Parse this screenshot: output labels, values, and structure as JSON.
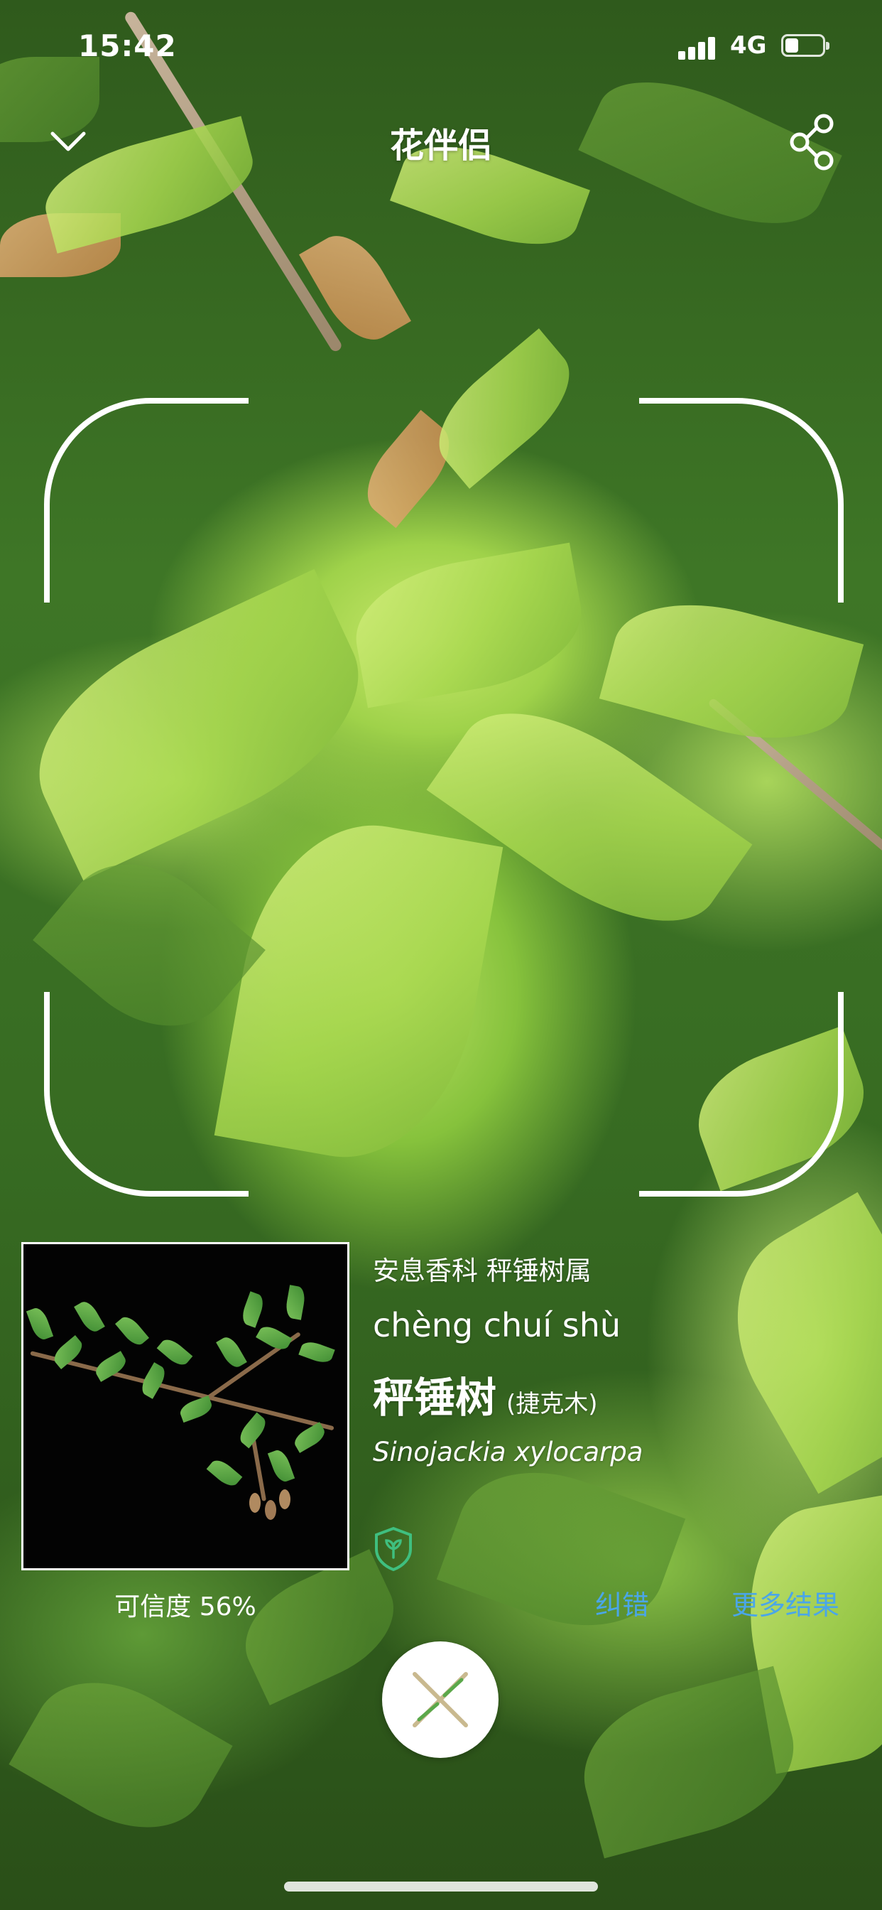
{
  "status_bar": {
    "time": "15:42",
    "network": "4G",
    "icons": [
      "signal-icon",
      "battery-icon"
    ]
  },
  "nav": {
    "title": "花伴侣",
    "left_icon": "chevron-down-icon",
    "right_icon": "share-icon"
  },
  "result": {
    "taxonomy": "安息香科 秤锤树属",
    "pinyin": "chèng chuí shù",
    "common_name": "秤锤树",
    "alias": "(捷克木)",
    "latin_name": "Sinojackia xylocarpa",
    "confidence": "可信度 56%",
    "badge_icon": "leaf-shield-icon",
    "correct_label": "纠错",
    "more_label": "更多结果"
  },
  "colors": {
    "link": "#4aa6e8",
    "overlay_text": "#ffffff"
  },
  "close_icon": "close-icon"
}
